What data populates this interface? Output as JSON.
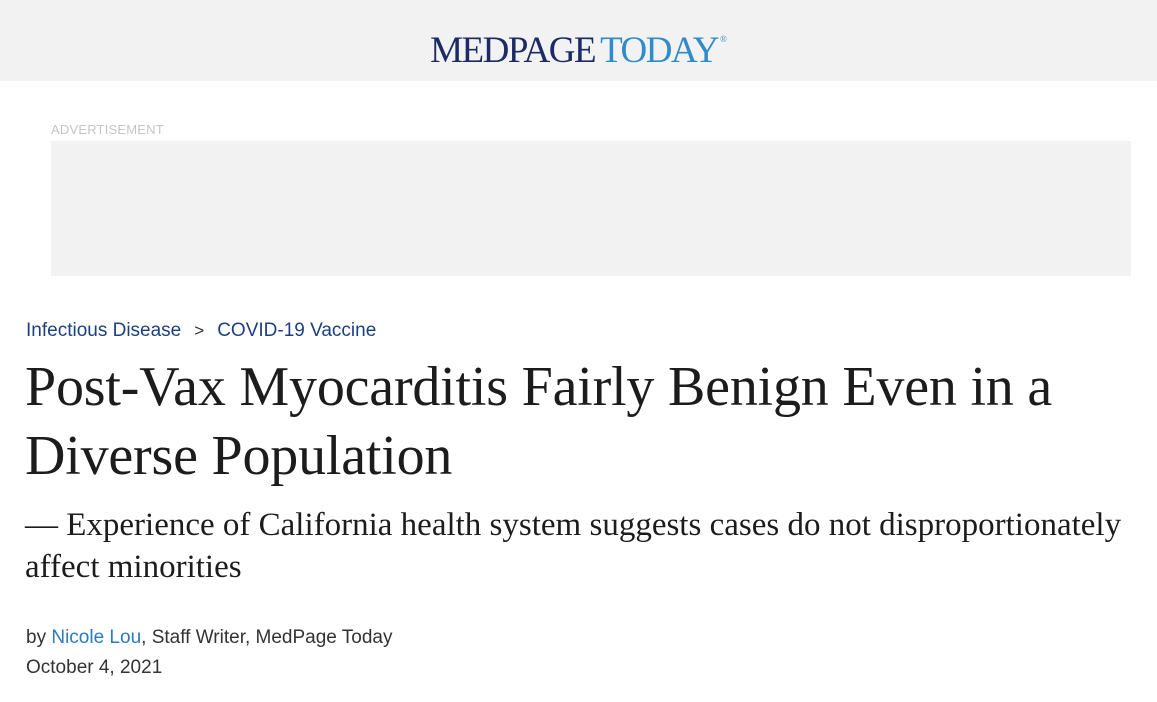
{
  "header": {
    "logo_part1": "MEDPAGE",
    "logo_part2": "TODAY",
    "logo_mark": "®",
    "background": "#f2f2f2",
    "logo_color_primary": "#1c2b66",
    "logo_color_accent": "#2f8bc9"
  },
  "advertisement": {
    "label": "ADVERTISEMENT"
  },
  "breadcrumb": {
    "items": [
      {
        "label": "Infectious Disease"
      },
      {
        "label": "COVID-19 Vaccine"
      }
    ],
    "separator": ">",
    "link_color": "#1c3f82"
  },
  "article": {
    "headline": "Post-Vax Myocarditis Fairly Benign Even in a Diverse Population",
    "subheadline": "— Experience of California health system suggests cases do not disproportionately affect minorities",
    "byline": {
      "prefix": "by",
      "author": "Nicole Lou",
      "role": ", Staff Writer, MedPage Today",
      "author_link_color": "#2b7bbf"
    },
    "date": "October 4, 2021"
  }
}
